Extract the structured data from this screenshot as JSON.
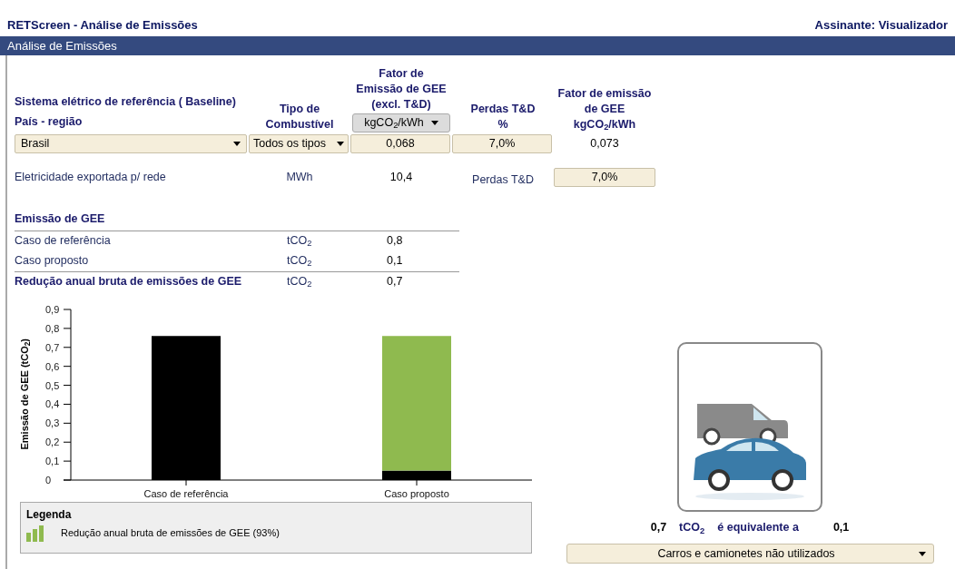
{
  "header": {
    "title": "RETScreen - Análise de Emissões",
    "subscriber": "Assinante: Visualizador"
  },
  "panel": {
    "title": "Análise de Emissões"
  },
  "baseline": {
    "heading": "Sistema elétrico de referência ( Baseline)",
    "country_label": "País - região",
    "fuel_heading": "Tipo de\nCombustível",
    "factor_heading": "Fator de\nEmissão de GEE\n(excl. T&D)",
    "factor_unit_select": "kgCO$_{2}$/kWh",
    "losses_heading": "Perdas T&D\n%",
    "result_heading": "Fator de emissão\nde GEE\nkgCO$_{2}$/kWh",
    "country": "Brasil",
    "fuel": "Todos os tipos",
    "factor": "0,068",
    "losses": "7,0%",
    "result": "0,073"
  },
  "export": {
    "label": "Eletricidade exportada p/ rede",
    "unit": "MWh",
    "value": "10,4",
    "losses_label": "Perdas T&D",
    "losses": "7,0%"
  },
  "emissions": {
    "heading": "Emissão de GEE",
    "rows": [
      {
        "label": "Caso de referência",
        "unit": "tCO$_{2}$",
        "value": "0,8",
        "kind": "normal"
      },
      {
        "label": "Caso proposto",
        "unit": "tCO$_{2}$",
        "value": "0,1",
        "kind": "normal"
      },
      {
        "label": "Redução anual bruta de emissões de GEE",
        "unit": "tCO$_{2}$",
        "value": "0,7",
        "kind": "total"
      }
    ]
  },
  "chart_data": {
    "type": "bar",
    "stacked": true,
    "ylabel": "Emissão de GEE (tCO$_{2}$)",
    "categories": [
      "Caso de referência",
      "Caso proposto"
    ],
    "series": [
      {
        "color": "#000000",
        "values": [
          0.76,
          0.05
        ]
      },
      {
        "name": "Redução anual bruta de emissões de GEE (93%)",
        "color": "#8fba4f",
        "values": [
          null,
          0.71
        ]
      }
    ],
    "ylim": [
      0,
      0.9
    ],
    "yticks": [
      {
        "value": 0,
        "label": "0"
      },
      {
        "value": 0.1,
        "label": "0,1"
      },
      {
        "value": 0.2,
        "label": "0,2"
      },
      {
        "value": 0.3,
        "label": "0,3"
      },
      {
        "value": 0.4,
        "label": "0,4"
      },
      {
        "value": 0.5,
        "label": "0,5"
      },
      {
        "value": 0.6,
        "label": "0,6"
      },
      {
        "value": 0.7,
        "label": "0,7"
      },
      {
        "value": 0.8,
        "label": "0,8"
      },
      {
        "value": 0.9,
        "label": "0,9"
      }
    ]
  },
  "legend": {
    "title": "Legenda"
  },
  "equivalence": {
    "value": "0,7",
    "unit": "tCO$_{2}$",
    "text": "é equivalente a",
    "result": "0,1",
    "selection": "Carros e camionetes não utilizados"
  }
}
